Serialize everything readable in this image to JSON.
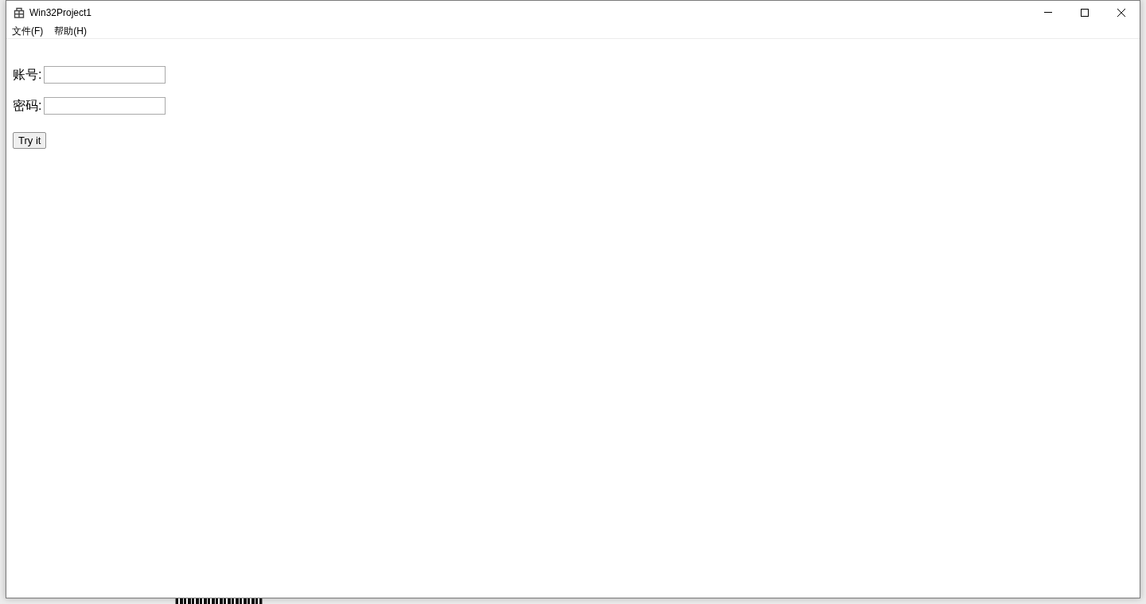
{
  "window": {
    "title": "Win32Project1"
  },
  "menu_bar": {
    "items": [
      "文件(F)",
      "帮助(H)"
    ]
  },
  "form": {
    "fields": [
      {
        "label": "账号:"
      },
      {
        "label": "密码:"
      }
    ],
    "button": "Try it"
  }
}
